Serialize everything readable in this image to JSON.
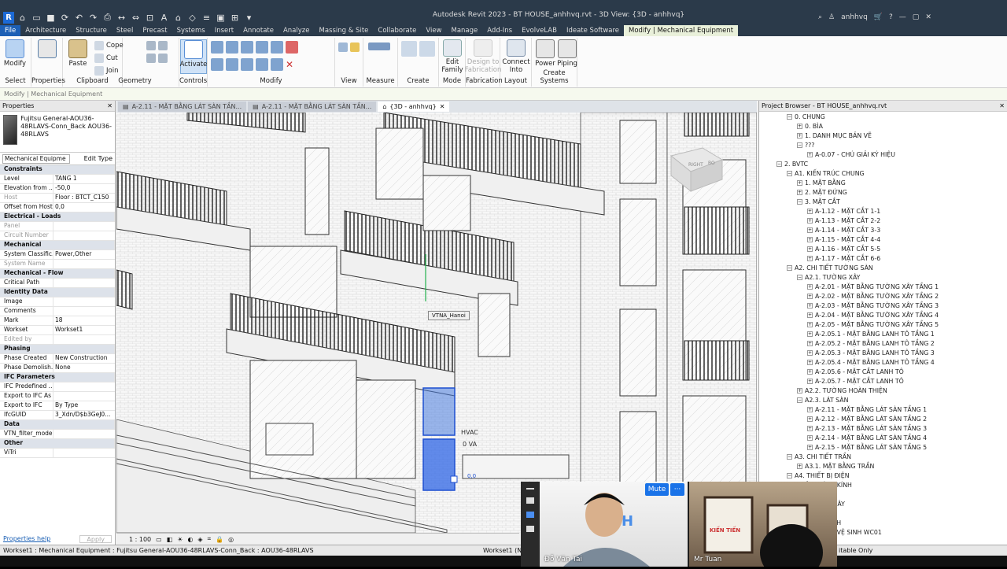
{
  "window": {
    "title": "Autodesk Revit 2023 - BT HOUSE_anhhvq.rvt - 3D View: {3D - anhhvq}",
    "user": "anhhvq"
  },
  "ribbon_tabs": [
    "File",
    "Architecture",
    "Structure",
    "Steel",
    "Precast",
    "Systems",
    "Insert",
    "Annotate",
    "Analyze",
    "Massing & Site",
    "Collaborate",
    "View",
    "Manage",
    "Add-Ins",
    "EvolveLAB",
    "Ideate Software",
    "Modify | Mechanical Equipment"
  ],
  "ribbon": {
    "modify": "Modify",
    "select": "Select",
    "properties": "Properties",
    "paste": "Paste",
    "clipboard": "Clipboard",
    "cope": "Cope",
    "cut": "Cut",
    "join": "Join",
    "geometry": "Geometry",
    "activate": "Activate",
    "controls": "Controls",
    "modify_panel": "Modify",
    "view": "View",
    "measure": "Measure",
    "create": "Create",
    "edit_family": "Edit Family",
    "mode": "Mode",
    "design_to_fab": "Design to Fabrication",
    "fabrication": "Fabrication",
    "connect_into": "Connect Into",
    "layout": "Layout",
    "power": "Power",
    "piping": "Piping",
    "create_systems": "Create Systems"
  },
  "options_bar": "Modify | Mechanical Equipment",
  "properties": {
    "title": "Properties",
    "type_name": "Fujitsu General-AOU36-48RLAVS-Conn_Back AOU36-48RLAVS",
    "instance_filter": "Mechanical Equipme",
    "edit_type": "Edit Type",
    "groups": [
      {
        "name": "Constraints",
        "rows": [
          [
            "Level",
            "TANG 1"
          ],
          [
            "Elevation from ...",
            "-50,0"
          ],
          [
            "Host",
            "Floor : BTCT_C150"
          ],
          [
            "Offset from Host",
            "0,0"
          ]
        ]
      },
      {
        "name": "Electrical - Loads",
        "rows": [
          [
            "Panel",
            ""
          ],
          [
            "Circuit Number",
            ""
          ]
        ]
      },
      {
        "name": "Mechanical",
        "rows": [
          [
            "System Classific...",
            "Power,Other"
          ],
          [
            "System Name",
            ""
          ]
        ]
      },
      {
        "name": "Mechanical - Flow",
        "rows": [
          [
            "Critical Path",
            ""
          ]
        ]
      },
      {
        "name": "Identity Data",
        "rows": [
          [
            "Image",
            ""
          ],
          [
            "Comments",
            ""
          ],
          [
            "Mark",
            "18"
          ],
          [
            "Workset",
            "Workset1"
          ],
          [
            "Edited by",
            ""
          ]
        ]
      },
      {
        "name": "Phasing",
        "rows": [
          [
            "Phase Created",
            "New Construction"
          ],
          [
            "Phase Demolish...",
            "None"
          ]
        ]
      },
      {
        "name": "IFC Parameters",
        "rows": [
          [
            "IFC Predefined ...",
            ""
          ],
          [
            "Export to IFC As",
            ""
          ],
          [
            "Export to IFC",
            "By Type"
          ],
          [
            "IfcGUID",
            "3_Xdn/D$b3GeJ0..."
          ]
        ]
      },
      {
        "name": "Data",
        "rows": [
          [
            "VTN_filter_model",
            ""
          ]
        ]
      },
      {
        "name": "Other",
        "rows": [
          [
            "ViTri",
            ""
          ]
        ]
      }
    ],
    "help": "Properties help",
    "apply": "Apply"
  },
  "doc_tabs": [
    "A-2.11 - MẶT BẰNG LÁT SÀN TẦN...",
    "A-2.11 - MẶT BẰNG LÁT SÀN TẦN...",
    "{3D - anhhvq}"
  ],
  "viewport": {
    "tag_label": "VTNA_Hanoi",
    "hvac": "HVAC",
    "va": "0 VA",
    "va2": "0,0",
    "viewcube_right": "RIGHT",
    "viewcube_back": "BO"
  },
  "view_control": {
    "scale": "1 : 100"
  },
  "browser": {
    "title": "Project Browser - BT HOUSE_anhhvq.rvt",
    "items": [
      {
        "level": 1,
        "toggle": "−",
        "text": "0. CHUNG"
      },
      {
        "level": 2,
        "toggle": "+",
        "text": "0. BÌA"
      },
      {
        "level": 2,
        "toggle": "+",
        "text": "1. DANH MỤC BẢN VẼ"
      },
      {
        "level": 2,
        "toggle": "−",
        "text": "???"
      },
      {
        "level": 3,
        "toggle": "+",
        "text": "A-0.07 - CHÚ GIẢI KÝ HIỆU"
      },
      {
        "level": 0,
        "toggle": "−",
        "text": "2. BVTC"
      },
      {
        "level": 1,
        "toggle": "−",
        "text": "A1. KIẾN TRÚC CHUNG"
      },
      {
        "level": 2,
        "toggle": "+",
        "text": "1. MẶT BẰNG"
      },
      {
        "level": 2,
        "toggle": "+",
        "text": "2. MẶT ĐỨNG"
      },
      {
        "level": 2,
        "toggle": "−",
        "text": "3. MẶT CẮT"
      },
      {
        "level": 3,
        "toggle": "+",
        "text": "A-1.12 - MẶT CẮT 1-1"
      },
      {
        "level": 3,
        "toggle": "+",
        "text": "A-1.13 - MẶT CẮT 2-2"
      },
      {
        "level": 3,
        "toggle": "+",
        "text": "A-1.14 - MẶT CẮT 3-3"
      },
      {
        "level": 3,
        "toggle": "+",
        "text": "A-1.15 - MẶT CẮT 4-4"
      },
      {
        "level": 3,
        "toggle": "+",
        "text": "A-1.16 - MẶT CẮT 5-5"
      },
      {
        "level": 3,
        "toggle": "+",
        "text": "A-1.17 - MẶT CẮT 6-6"
      },
      {
        "level": 1,
        "toggle": "−",
        "text": "A2. CHI TIẾT TƯỜNG SÀN"
      },
      {
        "level": 2,
        "toggle": "−",
        "text": "A2.1. TƯỜNG XÂY"
      },
      {
        "level": 3,
        "toggle": "+",
        "text": "A-2.01 - MẶT BẰNG TƯỜNG XÂY TẦNG 1"
      },
      {
        "level": 3,
        "toggle": "+",
        "text": "A-2.02 - MẶT BẰNG TƯỜNG XÂY TẦNG 2"
      },
      {
        "level": 3,
        "toggle": "+",
        "text": "A-2.03 - MẶT BẰNG TƯỜNG XÂY TẦNG 3"
      },
      {
        "level": 3,
        "toggle": "+",
        "text": "A-2.04 - MẶT BẰNG TƯỜNG XÂY TẦNG 4"
      },
      {
        "level": 3,
        "toggle": "+",
        "text": "A-2.05 - MẶT BẰNG TƯỜNG XÂY TẦNG 5"
      },
      {
        "level": 3,
        "toggle": "+",
        "text": "A-2.05.1 - MẶT BẰNG LANH TÔ TẦNG 1"
      },
      {
        "level": 3,
        "toggle": "+",
        "text": "A-2.05.2 - MẶT BẰNG LANH TÔ TẦNG 2"
      },
      {
        "level": 3,
        "toggle": "+",
        "text": "A-2.05.3 - MẶT BẰNG LANH TÔ TẦNG 3"
      },
      {
        "level": 3,
        "toggle": "+",
        "text": "A-2.05.4 - MẶT BẰNG LANH TÔ TẦNG 4"
      },
      {
        "level": 3,
        "toggle": "+",
        "text": "A-2.05.6 - MẶT CẮT LANH TÔ"
      },
      {
        "level": 3,
        "toggle": "+",
        "text": "A-2.05.7 - MẶT CẮT LANH TÔ"
      },
      {
        "level": 2,
        "toggle": "+",
        "text": "A2.2. TƯỜNG HOÀN THIỆN"
      },
      {
        "level": 2,
        "toggle": "−",
        "text": "A2.3. LÁT SÀN"
      },
      {
        "level": 3,
        "toggle": "+",
        "text": "A-2.11 - MẶT BẰNG LÁT SÀN TẦNG 1"
      },
      {
        "level": 3,
        "toggle": "+",
        "text": "A-2.12 - MẶT BẰNG LÁT SÀN TẦNG 2"
      },
      {
        "level": 3,
        "toggle": "+",
        "text": "A-2.13 - MẶT BẰNG LÁT SÀN TẦNG 3"
      },
      {
        "level": 3,
        "toggle": "+",
        "text": "A-2.14 - MẶT BẰNG LÁT SÀN TẦNG 4"
      },
      {
        "level": 3,
        "toggle": "+",
        "text": "A-2.15 - MẶT BẰNG LÁT SÀN TẦNG 5"
      },
      {
        "level": 1,
        "toggle": "−",
        "text": "A3. CHI TIẾT TRẦN"
      },
      {
        "level": 2,
        "toggle": "+",
        "text": "A3.1. MẶT BẰNG TRẦN"
      },
      {
        "level": 1,
        "toggle": "−",
        "text": "A4. THIẾT BỊ ĐIỆN"
      },
      {
        "level": 2,
        "toggle": "",
        "text": "ỬA, VÁCH KÍNH"
      },
      {
        "level": 2,
        "toggle": "",
        "text": "HÔNG"
      },
      {
        "level": 2,
        "toggle": "",
        "text": "ẢN, BỒN CÂY"
      },
      {
        "level": 2,
        "toggle": "",
        "text": ""
      },
      {
        "level": 2,
        "toggle": "",
        "text": "IẾT VỆ SINH"
      },
      {
        "level": 2,
        "toggle": "",
        "text": "- CHI TIẾT VỆ SINH WC01"
      }
    ]
  },
  "statusbar": {
    "text": "Workset1 : Mechanical Equipment : Fujitsu General-AOU36-48RLAVS-Conn_Back : AOU36-48RLAVS",
    "workset": "Workset1 (Nc",
    "editable": "itable Only"
  },
  "video": {
    "mute": "Mute",
    "more": "···",
    "person1": "Đỗ Văn Tài",
    "person2": "Mr Tuan",
    "poster_text": "KIẾN TIẾN"
  }
}
